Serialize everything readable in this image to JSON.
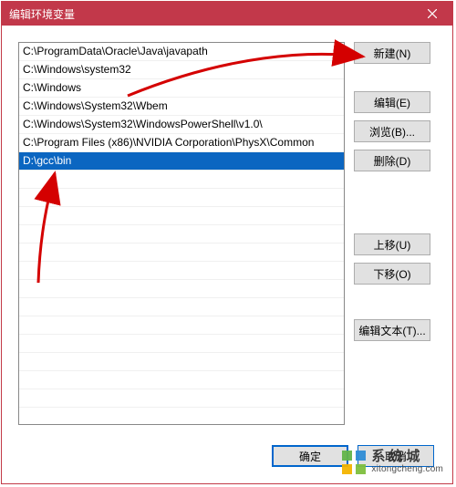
{
  "window": {
    "title": "编辑环境变量",
    "close_tooltip": "关闭"
  },
  "list": {
    "items": [
      "C:\\ProgramData\\Oracle\\Java\\javapath",
      "C:\\Windows\\system32",
      "C:\\Windows",
      "C:\\Windows\\System32\\Wbem",
      "C:\\Windows\\System32\\WindowsPowerShell\\v1.0\\",
      "C:\\Program Files (x86)\\NVIDIA Corporation\\PhysX\\Common",
      "D:\\gcc\\bin"
    ],
    "selected_index": 6,
    "blank_rows": 15
  },
  "buttons": {
    "new": "新建(N)",
    "edit": "编辑(E)",
    "browse": "浏览(B)...",
    "delete": "删除(D)",
    "move_up": "上移(U)",
    "move_down": "下移(O)",
    "edit_text": "编辑文本(T)...",
    "ok": "确定",
    "cancel": "取消"
  },
  "watermark": {
    "name": "系统城",
    "url": "xitongcheng.com"
  },
  "annotations": {
    "arrow1_target": "new-button",
    "arrow2_target": "selected-path"
  }
}
